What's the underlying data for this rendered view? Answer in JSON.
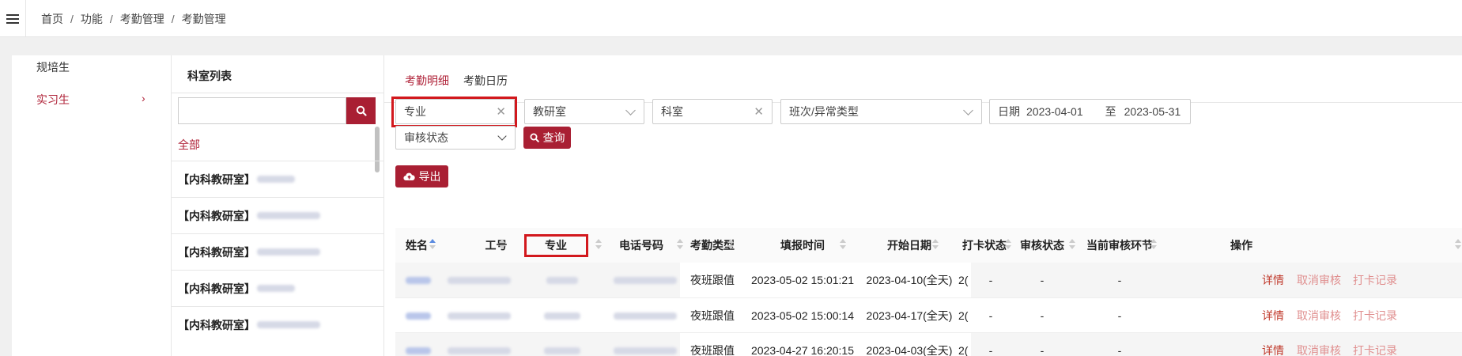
{
  "breadcrumb": [
    "首页",
    "功能",
    "考勤管理",
    "考勤管理"
  ],
  "categories": [
    {
      "label": "规培生",
      "active": false
    },
    {
      "label": "实习生",
      "active": true
    }
  ],
  "dept_panel": {
    "title": "科室列表",
    "search_value": "",
    "all_label": "全部",
    "items": [
      "【内科教研室】",
      "【内科教研室】",
      "【内科教研室】",
      "【内科教研室】",
      "【内科教研室】"
    ]
  },
  "tabs": [
    {
      "label": "考勤明细",
      "active": true
    },
    {
      "label": "考勤日历",
      "active": false
    }
  ],
  "filters": {
    "major": "专业",
    "teaching_office": "教研室",
    "department": "科室",
    "shift_type": "班次/异常类型",
    "date_label": "日期",
    "date_from": "2023-04-01",
    "date_sep": "至",
    "date_to": "2023-05-31",
    "review_status": "审核状态",
    "query_label": "查询",
    "export_label": "导出"
  },
  "table": {
    "headers": [
      "姓名",
      "工号",
      "专业",
      "电话号码",
      "考勤类型",
      "填报时间",
      "开始日期",
      "打卡状态",
      "审核状态",
      "当前审核环节",
      "操作"
    ],
    "rows": [
      {
        "type": "夜班跟值",
        "report_time": "2023-05-02 15:01:21",
        "start_date": "2023-04-10(全天)",
        "end_trunc": "2(",
        "clock_status": "-",
        "review_status": "-",
        "current_step": "-",
        "actions": [
          "详情",
          "取消审核",
          "打卡记录"
        ]
      },
      {
        "type": "夜班跟值",
        "report_time": "2023-05-02 15:00:14",
        "start_date": "2023-04-17(全天)",
        "end_trunc": "2(",
        "clock_status": "-",
        "review_status": "-",
        "current_step": "-",
        "actions": [
          "详情",
          "取消审核",
          "打卡记录"
        ]
      },
      {
        "type": "夜班跟值",
        "report_time": "2023-04-27 16:20:15",
        "start_date": "2023-04-03(全天)",
        "end_trunc": "2(",
        "clock_status": "-",
        "review_status": "-",
        "current_step": "-",
        "actions": [
          "详情",
          "取消审核",
          "打卡记录"
        ]
      }
    ]
  },
  "icons": {
    "menu": "hamburger-icon",
    "search": "search-icon",
    "export": "cloud-upload-icon",
    "clear": "close-icon",
    "sort": "sort-icon"
  },
  "colors": {
    "accent": "#a91f33",
    "highlight": "#d2181d",
    "link": "#c0392b"
  }
}
